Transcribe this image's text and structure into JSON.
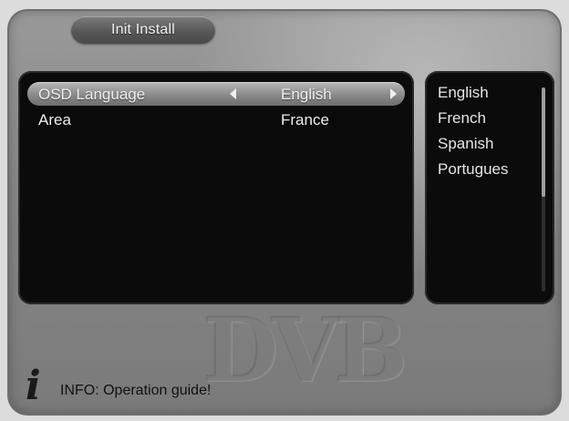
{
  "window": {
    "title": "Init Install"
  },
  "menu": {
    "rows": [
      {
        "label": "OSD Language",
        "value": "English"
      },
      {
        "label": "Area",
        "value": "France"
      }
    ]
  },
  "options": {
    "items": [
      "English",
      "French",
      "Spanish",
      "Portugues"
    ]
  },
  "logo": {
    "text": "DVB"
  },
  "footer": {
    "info_text": "INFO: Operation guide!",
    "icon": "info-icon"
  },
  "colors": {
    "panel_background": "#0b0b0b",
    "frame_background": "#878787",
    "text": "#eeeeee"
  }
}
